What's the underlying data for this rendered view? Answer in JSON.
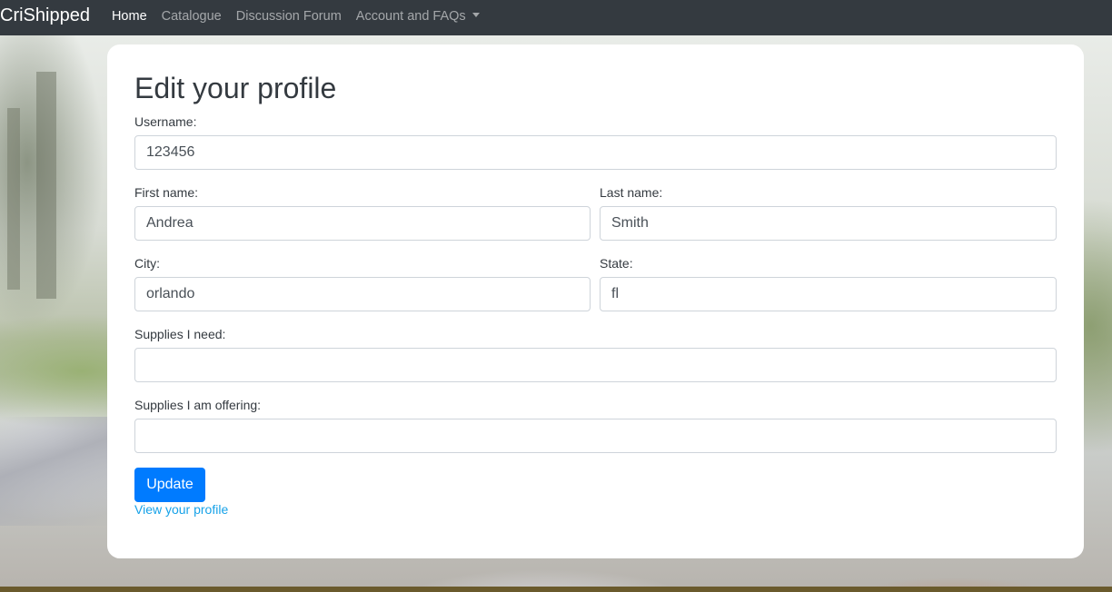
{
  "navbar": {
    "brand": "CriShipped",
    "links": [
      {
        "label": "Home",
        "active": true
      },
      {
        "label": "Catalogue",
        "active": false
      },
      {
        "label": "Discussion Forum",
        "active": false
      },
      {
        "label": "Account and FAQs",
        "active": false,
        "dropdown": true
      }
    ]
  },
  "form": {
    "title": "Edit your profile",
    "username": {
      "label": "Username:",
      "value": "123456"
    },
    "first_name": {
      "label": "First name:",
      "value": "Andrea"
    },
    "last_name": {
      "label": "Last name:",
      "value": "Smith"
    },
    "city": {
      "label": "City:",
      "value": "orlando"
    },
    "state": {
      "label": "State:",
      "value": "fl"
    },
    "supplies_need": {
      "label": "Supplies I need:",
      "value": ""
    },
    "supplies_offering": {
      "label": "Supplies I am offering:",
      "value": ""
    },
    "update_label": "Update",
    "view_profile_label": "View your profile"
  },
  "colors": {
    "navbar_bg": "#343a40",
    "primary_button": "#007bff",
    "link": "#17a2e8"
  }
}
